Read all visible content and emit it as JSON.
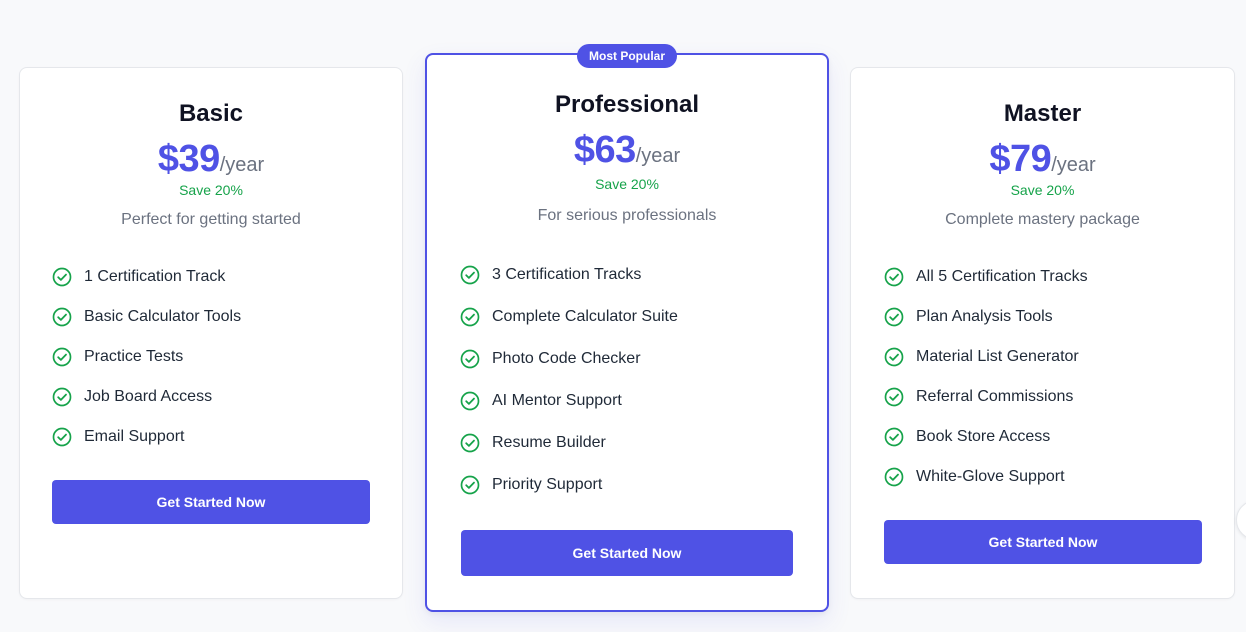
{
  "plans": [
    {
      "name": "Basic",
      "price": "$39",
      "period": "/year",
      "save": "Save 20%",
      "description": "Perfect for getting started",
      "features": [
        "1 Certification Track",
        "Basic Calculator Tools",
        "Practice Tests",
        "Job Board Access",
        "Email Support"
      ],
      "cta": "Get Started Now"
    },
    {
      "name": "Professional",
      "badge": "Most Popular",
      "price": "$63",
      "period": "/year",
      "save": "Save 20%",
      "description": "For serious professionals",
      "features": [
        "3 Certification Tracks",
        "Complete Calculator Suite",
        "Photo Code Checker",
        "AI Mentor Support",
        "Resume Builder",
        "Priority Support"
      ],
      "cta": "Get Started Now"
    },
    {
      "name": "Master",
      "price": "$79",
      "period": "/year",
      "save": "Save 20%",
      "description": "Complete mastery package",
      "features": [
        "All 5 Certification Tracks",
        "Plan Analysis Tools",
        "Material List Generator",
        "Referral Commissions",
        "Book Store Access",
        "White-Glove Support"
      ],
      "cta": "Get Started Now"
    }
  ],
  "icons": {
    "feature": "check-circle-icon"
  },
  "colors": {
    "accent": "#4f52e5",
    "success": "#16a34a",
    "muted": "#6b7280"
  }
}
